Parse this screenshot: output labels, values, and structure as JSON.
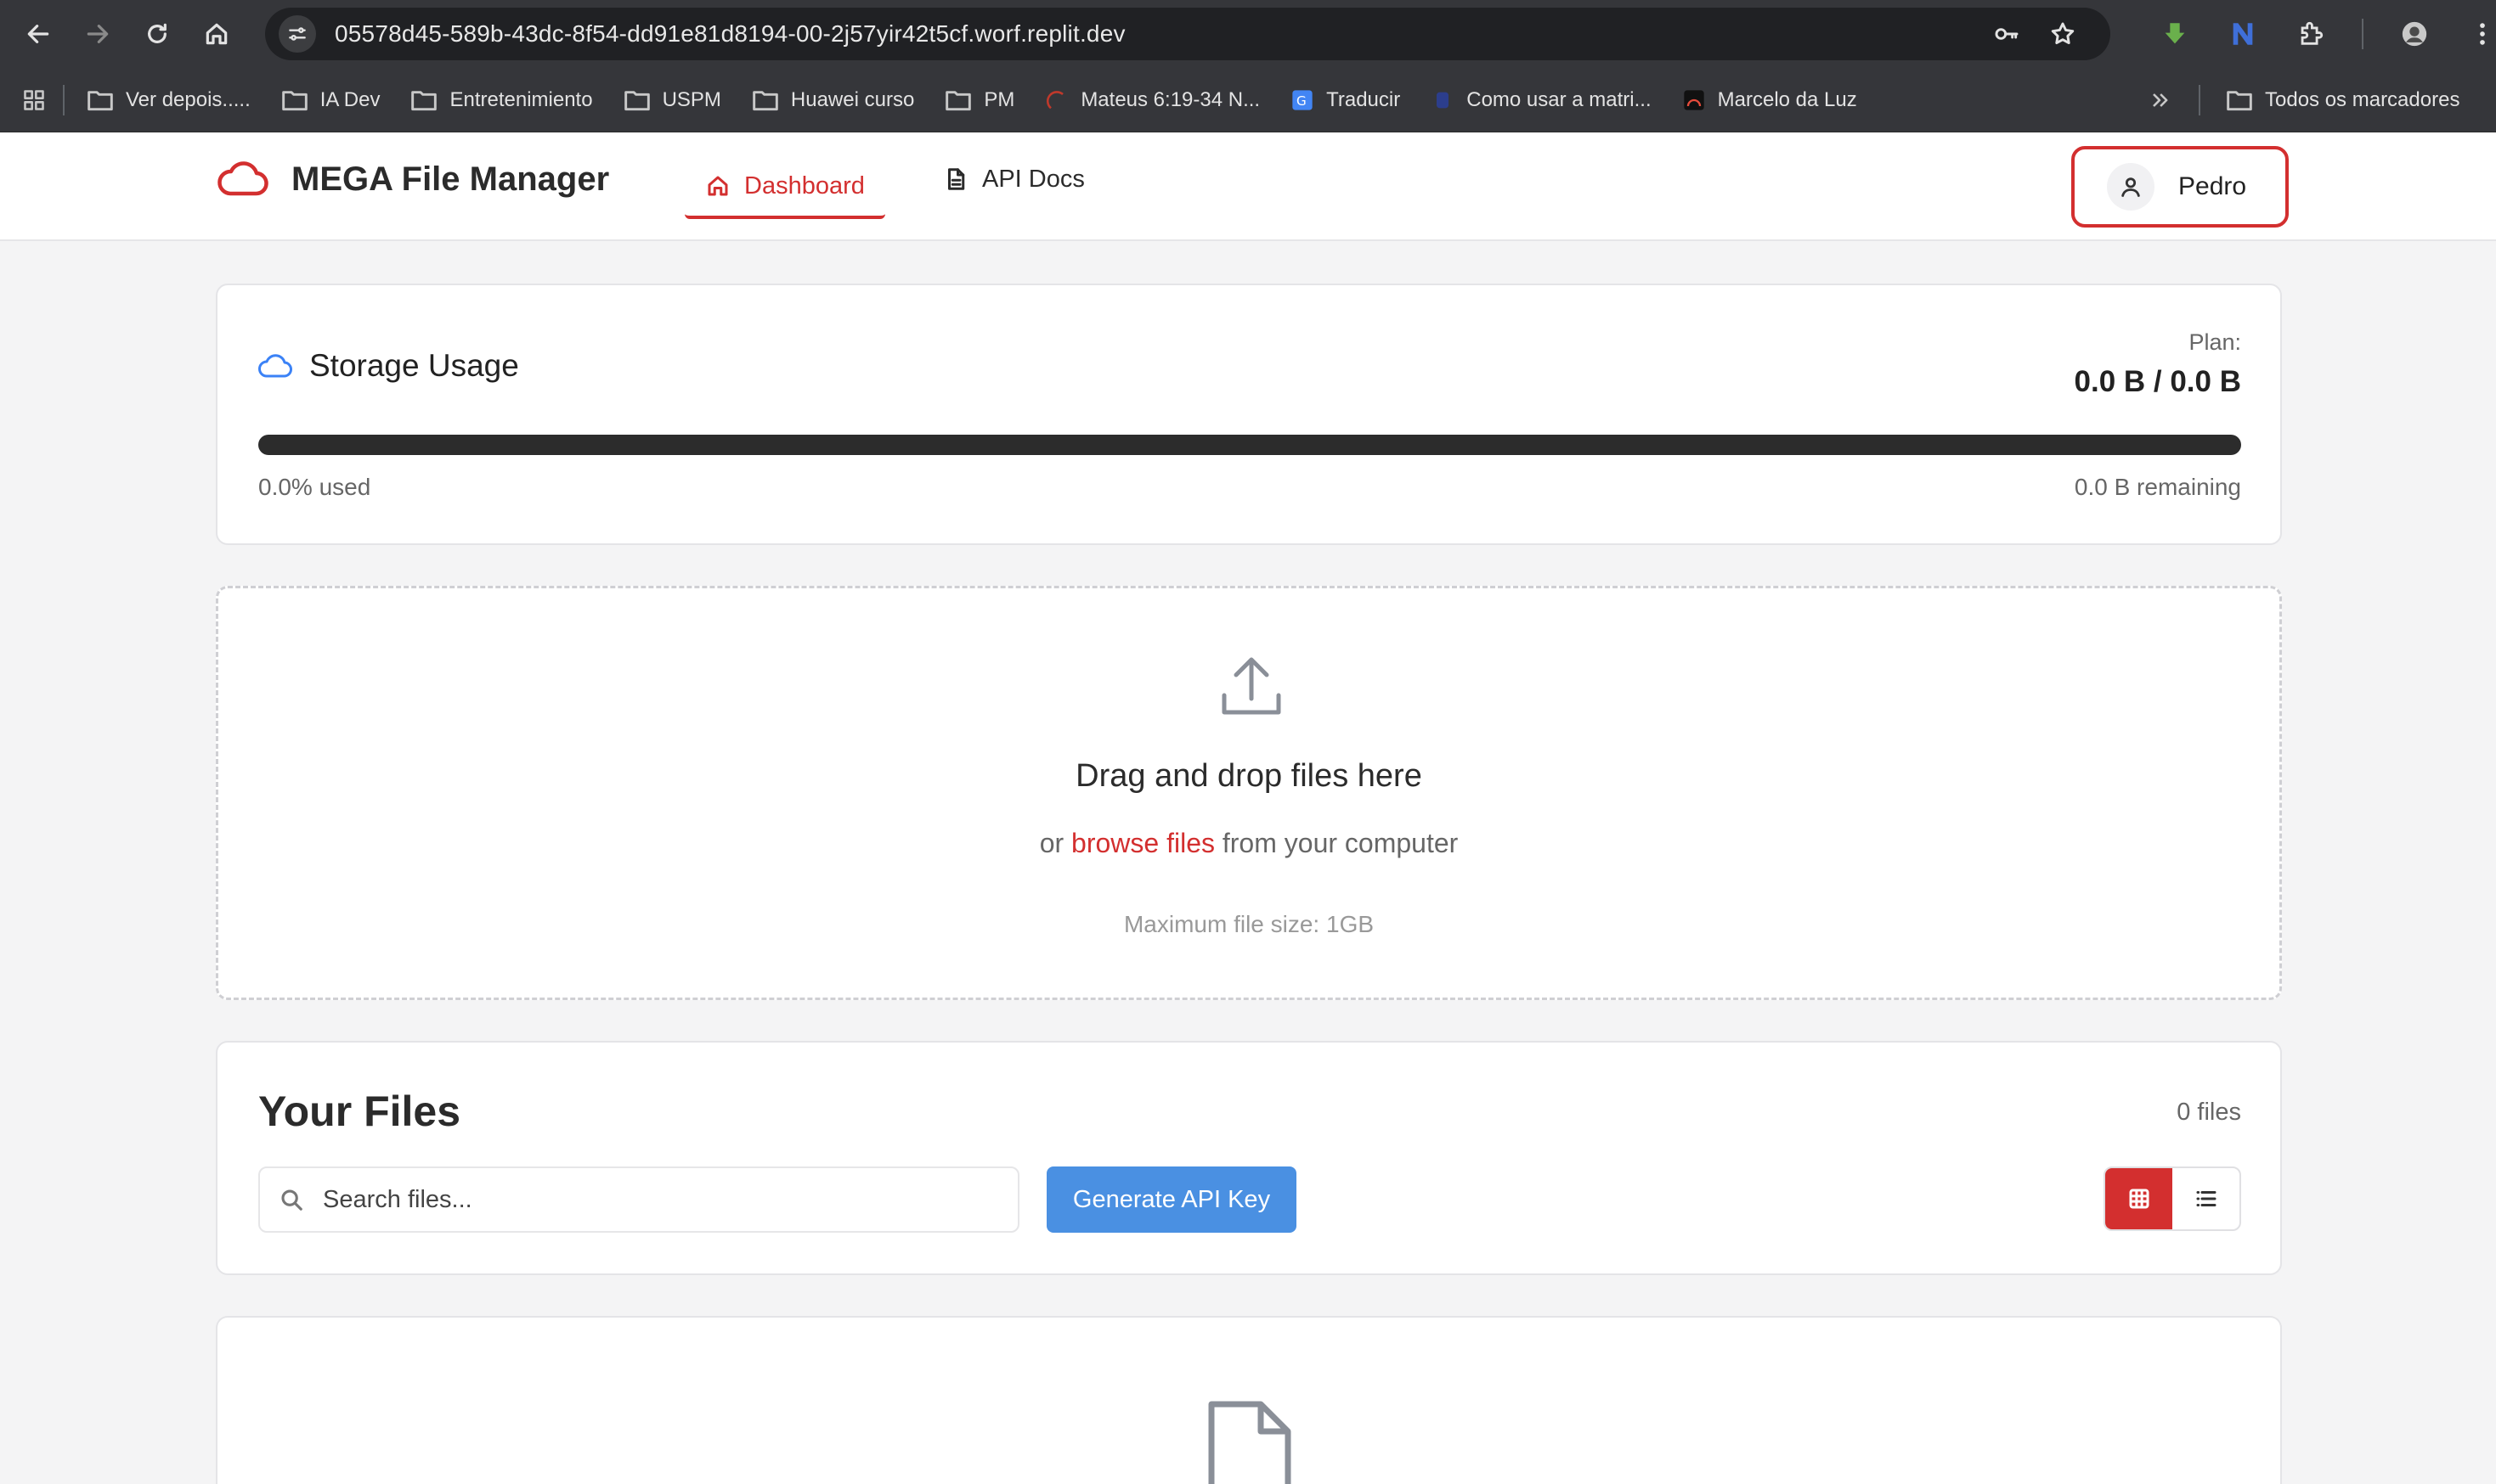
{
  "browser": {
    "url": "05578d45-589b-43dc-8f54-dd91e81d8194-00-2j57yir42t5cf.worf.replit.dev",
    "bookmarks": [
      {
        "label": "Ver depois.....",
        "icon": "folder-icon"
      },
      {
        "label": "IA Dev",
        "icon": "folder-icon"
      },
      {
        "label": "Entretenimiento",
        "icon": "folder-icon"
      },
      {
        "label": "USPM",
        "icon": "folder-icon"
      },
      {
        "label": "Huawei curso",
        "icon": "folder-icon"
      },
      {
        "label": "PM",
        "icon": "folder-icon"
      },
      {
        "label": "Mateus 6:19-34 N...",
        "icon": "site-favicon"
      },
      {
        "label": "Traducir",
        "icon": "google-translate-icon"
      },
      {
        "label": "Como usar a matri...",
        "icon": "site-favicon"
      },
      {
        "label": "Marcelo da Luz",
        "icon": "site-favicon"
      }
    ],
    "all_bookmarks": "Todos os marcadores"
  },
  "header": {
    "app_name": "MEGA File Manager",
    "tabs": [
      {
        "label": "Dashboard",
        "icon": "home-icon",
        "active": true
      },
      {
        "label": "API Docs",
        "icon": "document-icon",
        "active": false
      }
    ],
    "user_name": "Pedro"
  },
  "storage": {
    "title": "Storage Usage",
    "plan_label": "Plan:",
    "plan_value": "0.0 B / 0.0 B",
    "used_percent": 0,
    "used_text": "0.0% used",
    "remaining_text": "0.0 B remaining"
  },
  "dropzone": {
    "title": "Drag and drop files here",
    "sub_prefix": "or",
    "browse_link": "browse files",
    "sub_suffix": "from your computer",
    "note": "Maximum file size: 1GB"
  },
  "files": {
    "heading": "Your Files",
    "count": "0 files",
    "search_placeholder": "Search files...",
    "api_button": "Generate API Key",
    "view_modes": [
      "grid",
      "list"
    ],
    "active_view": "grid"
  },
  "colors": {
    "accent": "#d32f2f",
    "primary_button": "#4a90e2",
    "cloud_icon": "#3b82f6"
  }
}
